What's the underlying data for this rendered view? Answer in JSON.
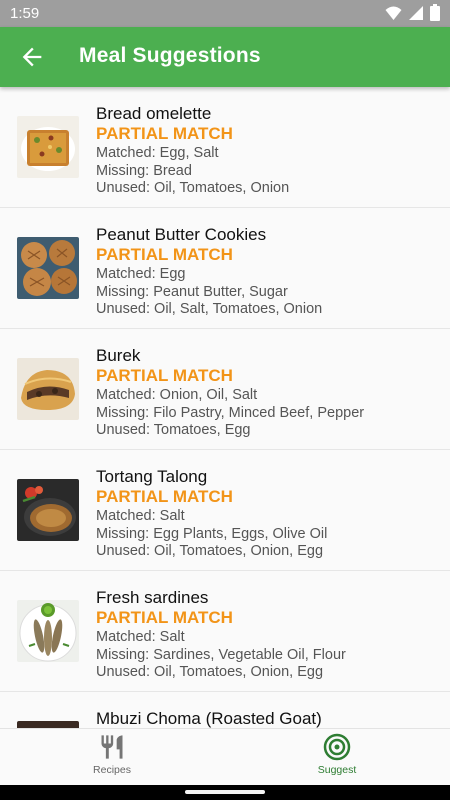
{
  "status_bar": {
    "time": "1:59"
  },
  "app_bar": {
    "title": "Meal Suggestions"
  },
  "suggestions": [
    {
      "title": "Bread omelette",
      "badge": "PARTIAL MATCH",
      "matched": "Matched: Egg, Salt",
      "missing": "Missing: Bread",
      "unused": "Unused: Oil, Tomatoes, Onion"
    },
    {
      "title": "Peanut Butter Cookies",
      "badge": "PARTIAL MATCH",
      "matched": "Matched: Egg",
      "missing": "Missing: Peanut Butter, Sugar",
      "unused": "Unused: Oil, Salt, Tomatoes, Onion"
    },
    {
      "title": "Burek",
      "badge": "PARTIAL MATCH",
      "matched": "Matched: Onion, Oil, Salt",
      "missing": "Missing: Filo Pastry, Minced Beef, Pepper",
      "unused": "Unused: Tomatoes, Egg"
    },
    {
      "title": "Tortang Talong",
      "badge": "PARTIAL MATCH",
      "matched": "Matched: Salt",
      "missing": "Missing: Egg Plants, Eggs, Olive Oil",
      "unused": "Unused: Oil, Tomatoes, Onion, Egg"
    },
    {
      "title": "Fresh sardines",
      "badge": "PARTIAL MATCH",
      "matched": "Matched: Salt",
      "missing": "Missing: Sardines, Vegetable Oil, Flour",
      "unused": "Unused: Oil, Tomatoes, Onion, Egg"
    },
    {
      "title": "Mbuzi Choma (Roasted Goat)"
    }
  ],
  "bottom_nav": {
    "recipes_label": "Recipes",
    "suggest_label": "Suggest",
    "active": "Suggest",
    "active_color": "#2e7d32",
    "inactive_color": "#666666"
  },
  "colors": {
    "app_bar": "#4caf50",
    "badge": "#f29418"
  }
}
